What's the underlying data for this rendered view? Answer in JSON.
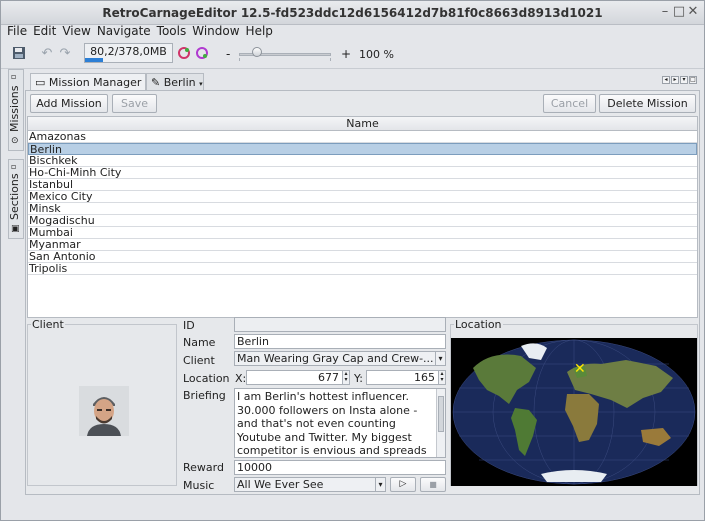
{
  "window": {
    "title": "RetroCarnageEditor 12.5-fd523ddc12d6156412d7b81f0c8663d8913d1021"
  },
  "menu": [
    "File",
    "Edit",
    "View",
    "Navigate",
    "Tools",
    "Window",
    "Help"
  ],
  "toolbar": {
    "memory": "80,2/378,0MB",
    "memory_fraction": 0.21,
    "zoom_minus": "-",
    "zoom_plus": "+",
    "zoom_value": "100 %",
    "zoom_fraction": 0.15
  },
  "side_tabs": {
    "missions": "Missions",
    "sections": "Sections"
  },
  "tabs": [
    {
      "label": "Mission Manager"
    },
    {
      "label": "Berlin"
    }
  ],
  "buttons": {
    "add": "Add Mission",
    "save": "Save",
    "cancel": "Cancel",
    "delete": "Delete Mission"
  },
  "table": {
    "header": "Name",
    "rows": [
      "Amazonas",
      "Berlin",
      "Bischkek",
      "Ho-Chi-Minh City",
      "Istanbul",
      "Mexico City",
      "Minsk",
      "Mogadischu",
      "Mumbai",
      "Myanmar",
      "San Antonio",
      "Tripolis"
    ],
    "selected": 1
  },
  "client": {
    "legend": "Client"
  },
  "form": {
    "id_label": "ID",
    "id_value": "",
    "name_label": "Name",
    "name_value": "Berlin",
    "client_label": "Client",
    "client_value": "Man Wearing Gray Cap and Crew-...",
    "location_label": "Location",
    "x_label": "X:",
    "x_value": "677",
    "y_label": "Y:",
    "y_value": "165",
    "briefing_label": "Briefing",
    "briefing_value": "I am Berlin's hottest influencer. 30.000 followers on Insta alone - and that's not even counting Youtube and Twitter. My biggest competitor is envious and spreads the rumour",
    "reward_label": "Reward",
    "reward_value": "10000",
    "music_label": "Music",
    "music_value": "All We Ever See"
  },
  "location": {
    "legend": "Location",
    "marker": "✕"
  }
}
